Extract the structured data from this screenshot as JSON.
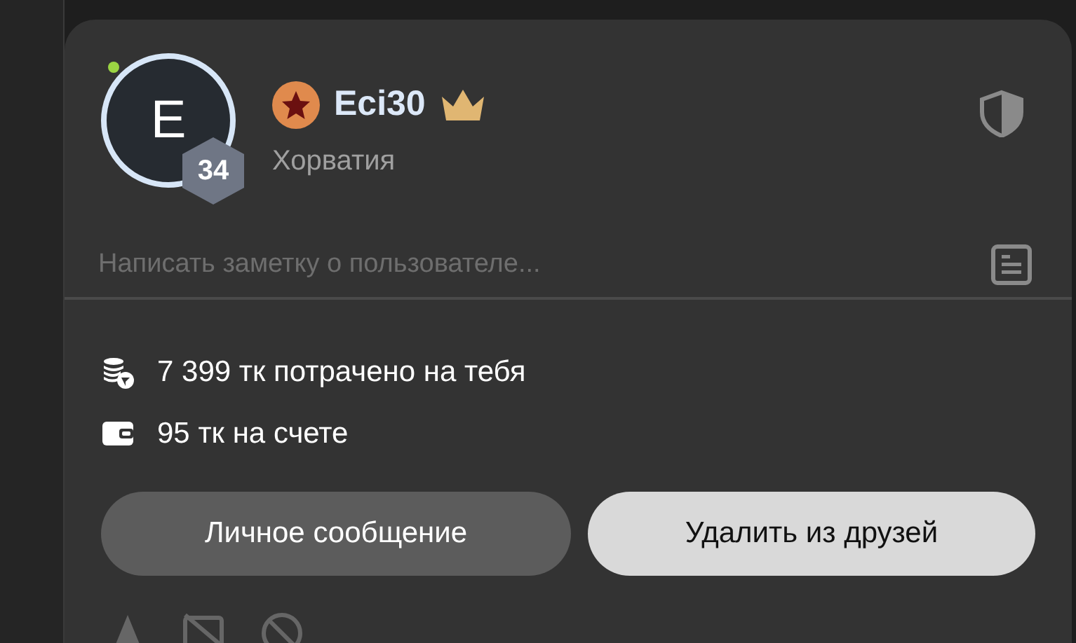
{
  "profile": {
    "avatar_letter": "E",
    "online": true,
    "level": "34",
    "name": "Eci30",
    "country": "Хорватия"
  },
  "note": {
    "placeholder": "Написать заметку о пользователе..."
  },
  "stats": [
    {
      "kind": "spent",
      "text": "7 399 тк потрачено на тебя"
    },
    {
      "kind": "balance",
      "text": "95 тк на счете"
    }
  ],
  "buttons": [
    {
      "kind": "secondary",
      "label": "Личное сообщение"
    },
    {
      "kind": "primary",
      "label": "Удалить из друзей"
    }
  ]
}
